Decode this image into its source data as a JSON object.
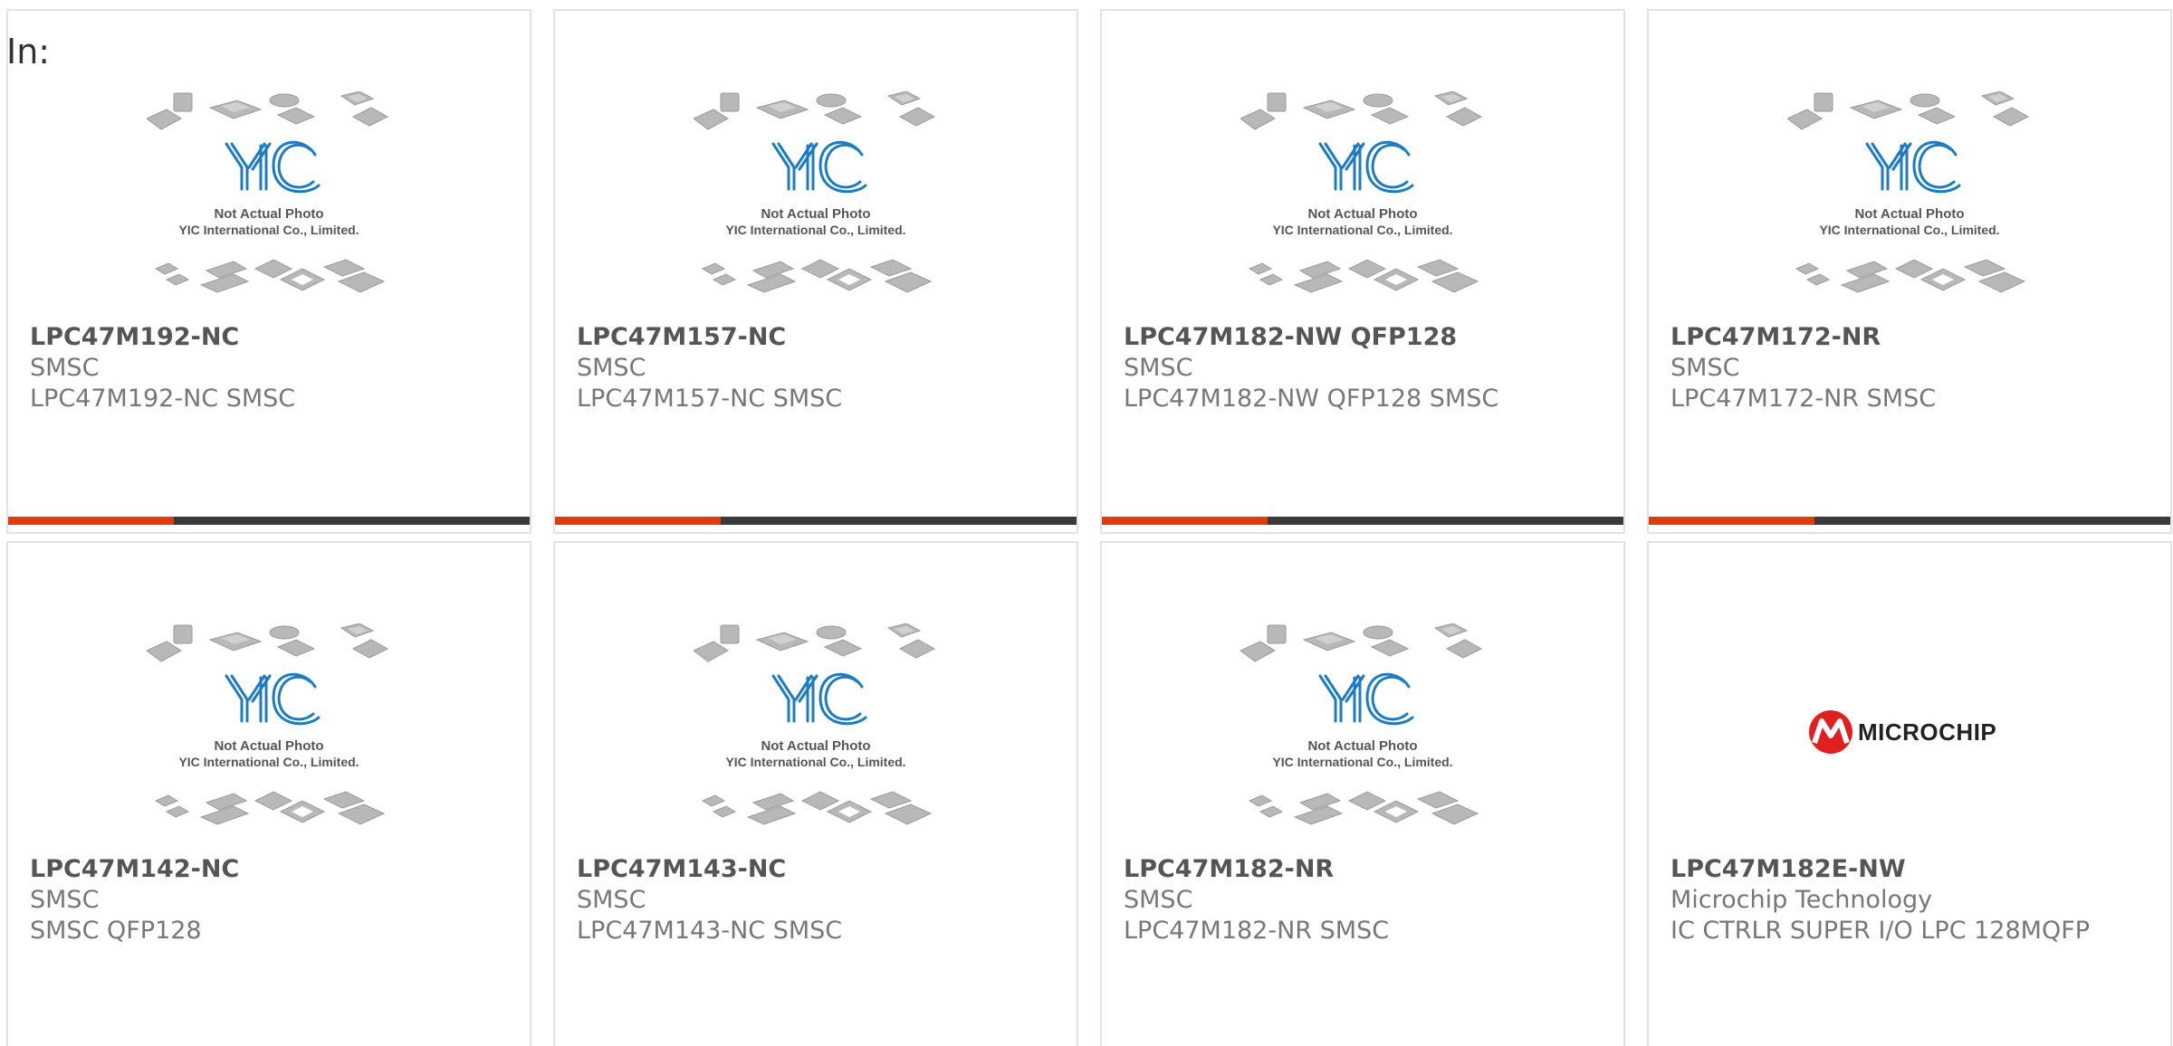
{
  "filter_label": "In:",
  "placeholder_image": {
    "logo_text": "YIC",
    "line1": "Not Actual Photo",
    "line2": "YIC International Co., Limited."
  },
  "colors": {
    "accent": "#e23a0b",
    "bar": "#3a3a3a",
    "border": "#e2e2e2",
    "yic_blue": "#1e7bbf",
    "microchip_red": "#e02020"
  },
  "products": [
    {
      "part": "LPC47M192-NC",
      "manufacturer": "SMSC",
      "description": "LPC47M192-NC SMSC",
      "image": "yic-placeholder",
      "has_bar": true
    },
    {
      "part": "LPC47M157-NC",
      "manufacturer": "SMSC",
      "description": "LPC47M157-NC SMSC",
      "image": "yic-placeholder",
      "has_bar": true
    },
    {
      "part": "LPC47M182-NW QFP128",
      "manufacturer": "SMSC",
      "description": "LPC47M182-NW QFP128 SMSC",
      "image": "yic-placeholder",
      "has_bar": true
    },
    {
      "part": "LPC47M172-NR",
      "manufacturer": "SMSC",
      "description": "LPC47M172-NR SMSC",
      "image": "yic-placeholder",
      "has_bar": true
    },
    {
      "part": "LPC47M142-NC",
      "manufacturer": "SMSC",
      "description": "SMSC QFP128",
      "image": "yic-placeholder",
      "has_bar": false
    },
    {
      "part": "LPC47M143-NC",
      "manufacturer": "SMSC",
      "description": "LPC47M143-NC SMSC",
      "image": "yic-placeholder",
      "has_bar": false
    },
    {
      "part": "LPC47M182-NR",
      "manufacturer": "SMSC",
      "description": "LPC47M182-NR SMSC",
      "image": "yic-placeholder",
      "has_bar": false
    },
    {
      "part": "LPC47M182E-NW",
      "manufacturer": "Microchip Technology",
      "description": "IC CTRLR SUPER I/O LPC 128MQFP",
      "image": "microchip-logo",
      "has_bar": false
    }
  ],
  "microchip_logo": {
    "text": "MICROCHIP"
  }
}
